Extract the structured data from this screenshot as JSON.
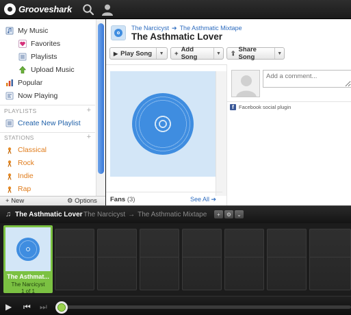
{
  "app": {
    "name": "Grooveshark"
  },
  "sidebar": {
    "items": [
      {
        "label": "My Music"
      },
      {
        "label": "Favorites"
      },
      {
        "label": "Playlists"
      },
      {
        "label": "Upload Music"
      },
      {
        "label": "Popular"
      },
      {
        "label": "Now Playing"
      }
    ],
    "playlists_heading": "PLAYLISTS",
    "create_playlist": "Create New Playlist",
    "stations_heading": "STATIONS",
    "stations": [
      "Classical",
      "Rock",
      "Indie",
      "Rap"
    ],
    "footer_new": "New",
    "footer_options": "Options"
  },
  "song_page": {
    "artist": "The Narcicyst",
    "album": "The Asthmatic Mixtape",
    "title": "The Asthmatic Lover",
    "buttons": {
      "play": "Play Song",
      "add": "Add Song",
      "share": "Share Song"
    },
    "fans_label": "Fans",
    "fans_count": "(3)",
    "see_all": "See All",
    "comment_placeholder": "Add a comment...",
    "fb_plugin": "Facebook social plugin"
  },
  "now_playing": {
    "song": "The Asthmatic Lover",
    "artist": "The Narcicyst",
    "album": "The Asthmatic Mixtape"
  },
  "queue": {
    "active": {
      "title": "The Asthmat...",
      "artist": "The Narcicyst",
      "position": "1 of 1"
    }
  },
  "colors": {
    "accent_blue": "#2d6cbf",
    "station_orange": "#e07b1a",
    "queue_green": "#7bc142"
  },
  "playback": {
    "progress": 0.0
  }
}
